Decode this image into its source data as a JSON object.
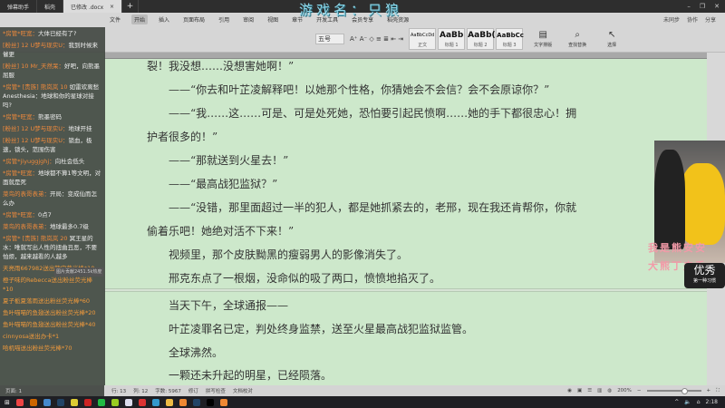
{
  "titlebar": {
    "tabs": [
      "弹幕助手",
      "稻壳",
      "已修改 .docx"
    ],
    "add": "+"
  },
  "watermark": "游戏名：只狼",
  "ribbon": {
    "menu": [
      "文件",
      "开始",
      "插入",
      "页面布局",
      "引用",
      "审阅",
      "视图",
      "章节",
      "开发工具",
      "会员专享",
      "稻壳资源"
    ],
    "active_menu": "开始",
    "right": [
      "未同步",
      "协作",
      "分享"
    ],
    "font_size": "五号",
    "styles": [
      {
        "preview": "AaBbCcDd",
        "name": "正文"
      },
      {
        "preview": "AaBb",
        "name": "标题 1"
      },
      {
        "preview": "AaBb(",
        "name": "标题 2"
      },
      {
        "preview": "AaBbCc",
        "name": "标题 3"
      }
    ],
    "tools": [
      "文字排版",
      "查找替换",
      "选择"
    ]
  },
  "document": {
    "lines": [
      "裂！我没想……没想害她啊！”",
      "——“你去和叶芷凌解释吧！以她那个性格，你猜她会不会信？会不会原谅你？”",
      "——“我……这……可是、可是处死她，恐怕要引起民愤啊……她的手下都很忠心！拥",
      "护者很多的！”",
      "——“那就送到火星去！”",
      "——“最高战犯监狱？”",
      "——“没错，那里面超过一半的犯人，都是她抓紧去的，老邢，现在我还肯帮你，你就",
      "偷着乐吧！她绝对活不下来！”",
      "视频里，那个皮肤黝黑的瘦弱男人的影像消失了。",
      "邢克东点了一根烟，没命似的吸了两口，愤愤地掐灭了。",
      "当天下午，全球通报——",
      "叶芷凌罪名已定，判处终身监禁，送至火星最高战犯监狱监管。",
      "全球沸然。",
      "一颗还未升起的明星，已经陨落。"
    ]
  },
  "chat": {
    "messages": [
      {
        "user": "*房管*旺宽：",
        "text": "大体已经有了?"
      },
      {
        "user": "[粉丝] 12 U梦与现实U：",
        "text": "我到时候来催更"
      },
      {
        "user": "[粉丝] 10 Mr_天然呆：",
        "text": "好吧，向熊墨屈服"
      },
      {
        "user": "*房管* [贵族] 熊岚岚 10 ",
        "text": "如雷欢离愁Anesthesia：地球和你的星球对接吗?"
      },
      {
        "user": "*房管*旺宽：",
        "text": "熊墨密码"
      },
      {
        "user": "[粉丝] 12 U梦与现实U：",
        "text": "地球开挂"
      },
      {
        "user": "[粉丝] 12 U梦与现实U：",
        "text": "锁血，极速，锁头，范围伤害"
      },
      {
        "user": "*房管*jiyuggjghj：",
        "text": "向杜会低头"
      },
      {
        "user": "*房管*旺宽：",
        "text": "地球都不算1等文明，对面就是死"
      },
      {
        "user": "菜鸟的表哥表弟：",
        "text": "开局：变成仙而怎么办"
      },
      {
        "user": "*房管*旺宽：",
        "text": "0点7"
      },
      {
        "user": "菜鸟的表哥表弟：",
        "text": "地球最多0.7级"
      },
      {
        "user": "*房管* [贵族] 熊岚岚 20 ",
        "text": "冥王星的水：唯就写出人性的扭曲丑恶，不要怕烦，越来越看的人越多"
      }
    ],
    "gifts": [
      "天亮雨667982送出熊宝荧光棒*10",
      "橙子味的Rebecca送出粉丝荧光棒*10",
      "夏子栀夏落雨送出粉丝荧光棒*60",
      "鱼叶喵喵的鱼翅送出粉丝荧光棒*20",
      "鱼叶喵喵的鱼翅送出粉丝荧光棒*40",
      "cinnyosa送出办卡*1",
      "哈机喵送出粉丝荧光棒*70"
    ],
    "insert_label": "图片贡献2451.5k热度"
  },
  "stream": {
    "overlay_line1": "我是熊安安",
    "overlay_line2": "大熊丁夫秀",
    "badge": "优秀",
    "badge_sub": "第一种习惯"
  },
  "status": {
    "page": "页面: 1",
    "row": "行: 13",
    "col": "列: 12",
    "words": "字数: 5967",
    "revise": "修订",
    "spell": "拼写检查",
    "compare": "文档校对",
    "zoom": "200%",
    "minus": "−",
    "plus": "+"
  },
  "taskbar": {
    "time": "2:18"
  }
}
